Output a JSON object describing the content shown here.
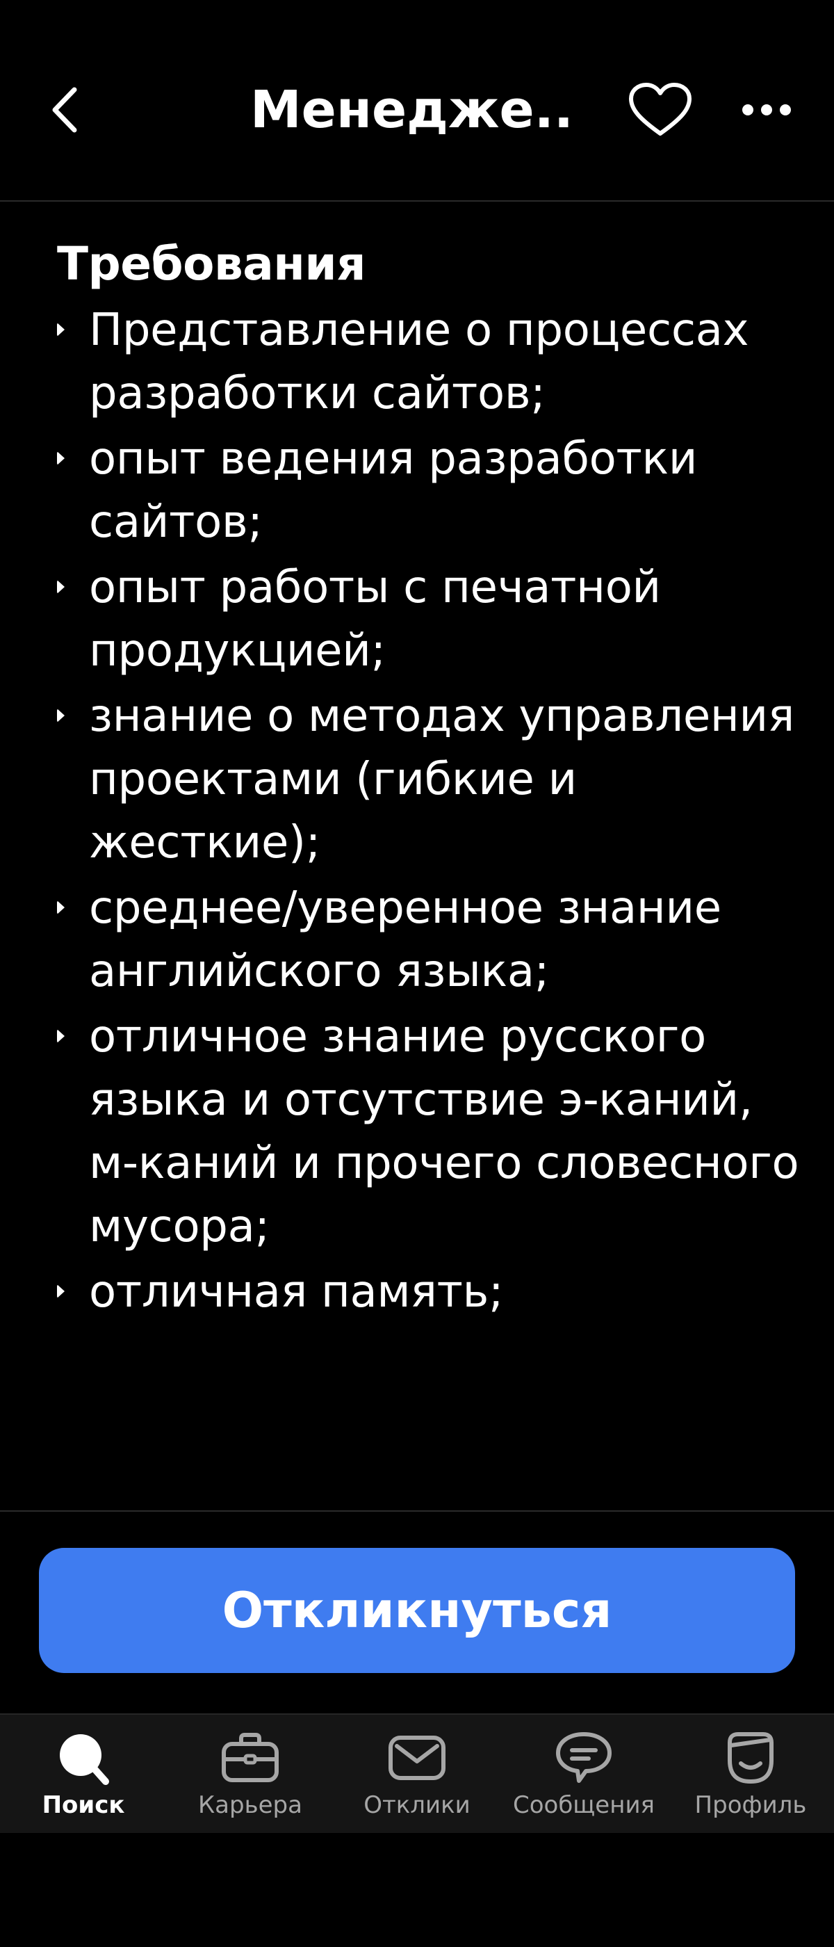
{
  "header": {
    "title": "Менедже...",
    "back_icon": "chevron-left-icon",
    "favorite_icon": "heart-icon",
    "more_icon": "more-dots-icon"
  },
  "section": {
    "title": "Требования",
    "items": [
      "Представление о процессах разработки сайтов;",
      "опыт ведения разработки сайтов;",
      "опыт работы с печатной продукцией;",
      "знание о методах управления проектами (гибкие и жесткие);",
      "среднее/уверенное знание английского языка;",
      "отличное знание русского языка и отсутствие э-каний, м-каний и прочего словесного мусора;",
      "отличная память;"
    ]
  },
  "actions": {
    "respond_label": "Откликнуться",
    "respond_color": "#3f7cf0"
  },
  "tabbar": {
    "tabs": [
      {
        "label": "Поиск",
        "icon": "search-icon",
        "active": true
      },
      {
        "label": "Карьера",
        "icon": "briefcase-icon",
        "active": false
      },
      {
        "label": "Отклики",
        "icon": "envelope-icon",
        "active": false
      },
      {
        "label": "Сообщения",
        "icon": "chat-bubble-icon",
        "active": false
      },
      {
        "label": "Профиль",
        "icon": "profile-icon",
        "active": false
      }
    ]
  }
}
